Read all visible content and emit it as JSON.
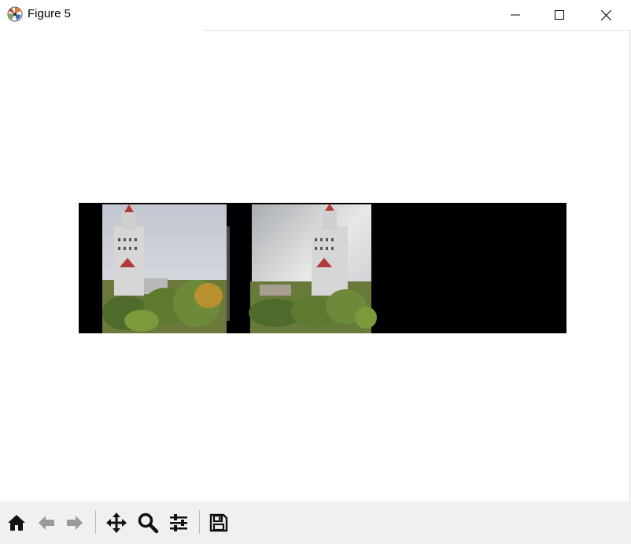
{
  "window": {
    "title": "Figure 5",
    "icons": {
      "app": "matplotlib-logo-icon",
      "minimize": "minimize-icon",
      "maximize": "maximize-icon",
      "close": "close-icon"
    }
  },
  "toolbar": {
    "buttons": [
      {
        "name": "home-button",
        "icon": "home-icon"
      },
      {
        "name": "back-button",
        "icon": "arrow-left-icon"
      },
      {
        "name": "forward-button",
        "icon": "arrow-right-icon"
      },
      {
        "name": "pan-button",
        "icon": "move-icon"
      },
      {
        "name": "zoom-button",
        "icon": "magnifier-icon"
      },
      {
        "name": "configure-subplots-button",
        "icon": "sliders-icon"
      },
      {
        "name": "save-button",
        "icon": "floppy-disk-icon"
      }
    ]
  },
  "figure": {
    "content": "stitched-panorama-image",
    "background": "#000000"
  },
  "colors": {
    "toolbar_bg": "#f0f0f0",
    "window_bg": "#ffffff",
    "sky": "#c9cdd6",
    "tower": "#d9d9d9",
    "roof_red": "#b33a3a",
    "trees": "#4f6b2c"
  }
}
